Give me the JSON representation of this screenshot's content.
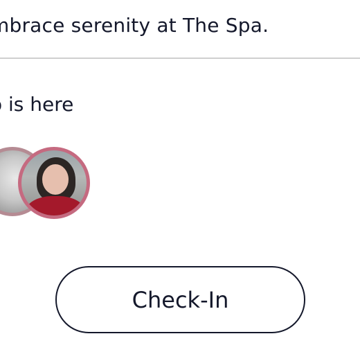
{
  "tagline": "mbrace serenity at The Spa.",
  "who_is_here": "o is here",
  "avatars": [
    {
      "name": "avatar-1"
    },
    {
      "name": "avatar-2"
    },
    {
      "name": "avatar-3"
    }
  ],
  "checkin_label": "Check-In",
  "colors": {
    "text": "#14182b",
    "divider": "#cfcfcf",
    "avatar_ring": "#c56a80"
  }
}
